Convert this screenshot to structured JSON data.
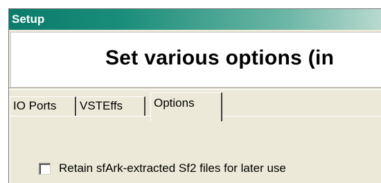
{
  "window": {
    "title": "Setup"
  },
  "header": {
    "title": "Set various options (in"
  },
  "tabs": [
    {
      "label": "IO Ports",
      "active": false
    },
    {
      "label": "VSTEffs",
      "active": false
    },
    {
      "label": "Options",
      "active": true
    }
  ],
  "options": {
    "retain_sfark": {
      "label": "Retain sfArk-extracted Sf2 files for later use",
      "checked": false
    }
  },
  "colors": {
    "titlebar_start": "#0b7b6a",
    "titlebar_end": "#b8d9cf",
    "panel": "#ece9d8"
  }
}
